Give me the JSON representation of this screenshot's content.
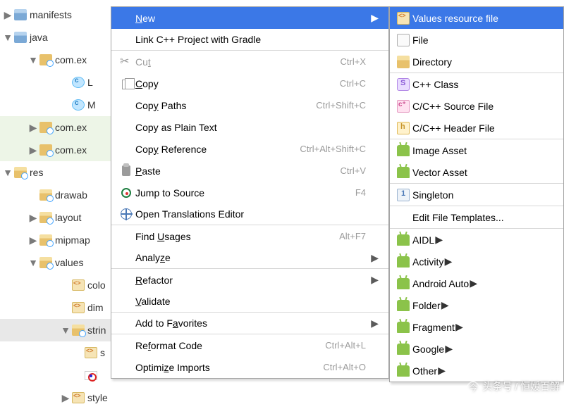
{
  "tree": {
    "rows": [
      {
        "indent": "ind0",
        "arrow": "▶",
        "iconCls": "fld-blue",
        "label": "manifests"
      },
      {
        "indent": "ind0",
        "arrow": "▼",
        "iconCls": "fld-blue",
        "label": "java"
      },
      {
        "indent": "ind2",
        "arrow": "▼",
        "iconCls": "pkg",
        "label": "com.ex"
      },
      {
        "indent": "ind4",
        "arrow": "",
        "iconCls": "cls",
        "label": "L"
      },
      {
        "indent": "ind4",
        "arrow": "",
        "iconCls": "cls",
        "label": "M"
      },
      {
        "indent": "ind2",
        "arrow": "▶",
        "iconCls": "pkg",
        "label": "com.ex",
        "hl": "hl1"
      },
      {
        "indent": "ind2",
        "arrow": "▶",
        "iconCls": "pkg",
        "label": "com.ex",
        "hl": "hl1"
      },
      {
        "indent": "ind0",
        "arrow": "▼",
        "iconCls": "fld-yellow",
        "label": "res"
      },
      {
        "indent": "ind2",
        "arrow": "",
        "iconCls": "fld-yellow",
        "label": "drawab"
      },
      {
        "indent": "ind2",
        "arrow": "▶",
        "iconCls": "fld-yellow",
        "label": "layout"
      },
      {
        "indent": "ind2",
        "arrow": "▶",
        "iconCls": "fld-yellow",
        "label": "mipmap"
      },
      {
        "indent": "ind2",
        "arrow": "▼",
        "iconCls": "fld-yellow",
        "label": "values"
      },
      {
        "indent": "ind4",
        "arrow": "",
        "iconCls": "xml",
        "label": "colo"
      },
      {
        "indent": "ind4",
        "arrow": "",
        "iconCls": "xml",
        "label": "dim"
      },
      {
        "indent": "ind4",
        "arrow": "▼",
        "iconCls": "fld-yellow",
        "label": "strin",
        "hl": "hl2"
      },
      {
        "indent": "ind5",
        "arrow": "",
        "iconCls": "xml",
        "label": "s"
      },
      {
        "indent": "ind5",
        "arrow": "",
        "iconCls": "flag",
        "label": ""
      },
      {
        "indent": "ind4",
        "arrow": "▶",
        "iconCls": "xml",
        "label": "style"
      }
    ]
  },
  "menu": {
    "items": [
      {
        "label_html": "<u>N</u>ew",
        "iconCls": "",
        "shortcut": "",
        "submenu": true,
        "highlight": true
      },
      {
        "label_html": "Link C++ Project with Gradle",
        "iconCls": "",
        "shortcut": "",
        "sep": true
      },
      {
        "label_html": "Cu<u>t</u>",
        "iconCls": "i-scissor",
        "shortcut": "Ctrl+X",
        "disabled": true
      },
      {
        "label_html": "<u>C</u>opy",
        "iconCls": "i-copy",
        "shortcut": "Ctrl+C"
      },
      {
        "label_html": "Cop<u>y</u> Paths",
        "iconCls": "",
        "shortcut": "Ctrl+Shift+C"
      },
      {
        "label_html": "Copy as Plain Text",
        "iconCls": "",
        "shortcut": ""
      },
      {
        "label_html": "Cop<u>y</u> Reference",
        "iconCls": "",
        "shortcut": "Ctrl+Alt+Shift+C"
      },
      {
        "label_html": "<u>P</u>aste",
        "iconCls": "i-paste",
        "shortcut": "Ctrl+V"
      },
      {
        "label_html": "Jump to Source",
        "iconCls": "i-target",
        "shortcut": "F4"
      },
      {
        "label_html": "Open Translations Editor",
        "iconCls": "i-globe",
        "shortcut": "",
        "sep": true
      },
      {
        "label_html": "Find <u>U</u>sages",
        "iconCls": "",
        "shortcut": "Alt+F7"
      },
      {
        "label_html": "Analy<u>z</u>e",
        "iconCls": "",
        "shortcut": "",
        "submenu": true,
        "sep": true
      },
      {
        "label_html": "<u>R</u>efactor",
        "iconCls": "",
        "shortcut": "",
        "submenu": true
      },
      {
        "label_html": "<u>V</u>alidate",
        "iconCls": "",
        "shortcut": "",
        "sep": true
      },
      {
        "label_html": "Add to F<u>a</u>vorites",
        "iconCls": "",
        "shortcut": "",
        "submenu": true,
        "sep": true
      },
      {
        "label_html": "Re<u>f</u>ormat Code",
        "iconCls": "",
        "shortcut": "Ctrl+Alt+L"
      },
      {
        "label_html": "Optimi<u>z</u>e Imports",
        "iconCls": "",
        "shortcut": "Ctrl+Alt+O"
      }
    ]
  },
  "submenu": {
    "items": [
      {
        "label": "Values resource file",
        "iconCls": "s-values",
        "highlight": true
      },
      {
        "label": "File",
        "iconCls": "s-file"
      },
      {
        "label": "Directory",
        "iconCls": "s-folder"
      },
      {
        "divider": true
      },
      {
        "label": "C++ Class",
        "iconCls": "s-S"
      },
      {
        "label": "C/C++ Source File",
        "iconCls": "s-cpp"
      },
      {
        "label": "C/C++ Header File",
        "iconCls": "s-h"
      },
      {
        "divider": true
      },
      {
        "label": "Image Asset",
        "iconCls": "s-android"
      },
      {
        "label": "Vector Asset",
        "iconCls": "s-android"
      },
      {
        "divider": true
      },
      {
        "label": "Singleton",
        "iconCls": "s-single"
      },
      {
        "divider": true
      },
      {
        "label": "Edit File Templates...",
        "iconCls": ""
      },
      {
        "divider": true
      },
      {
        "label": "AIDL",
        "iconCls": "s-android",
        "submenu": true
      },
      {
        "label": "Activity",
        "iconCls": "s-android",
        "submenu": true
      },
      {
        "label": "Android Auto",
        "iconCls": "s-android",
        "submenu": true
      },
      {
        "label": "Folder",
        "iconCls": "s-android",
        "submenu": true
      },
      {
        "label": "Fragment",
        "iconCls": "s-android",
        "submenu": true
      },
      {
        "label": "Google",
        "iconCls": "s-android",
        "submenu": true
      },
      {
        "label": "Other",
        "iconCls": "s-android",
        "submenu": true
      }
    ]
  },
  "watermark": "头条号 / 恒嫒百解"
}
